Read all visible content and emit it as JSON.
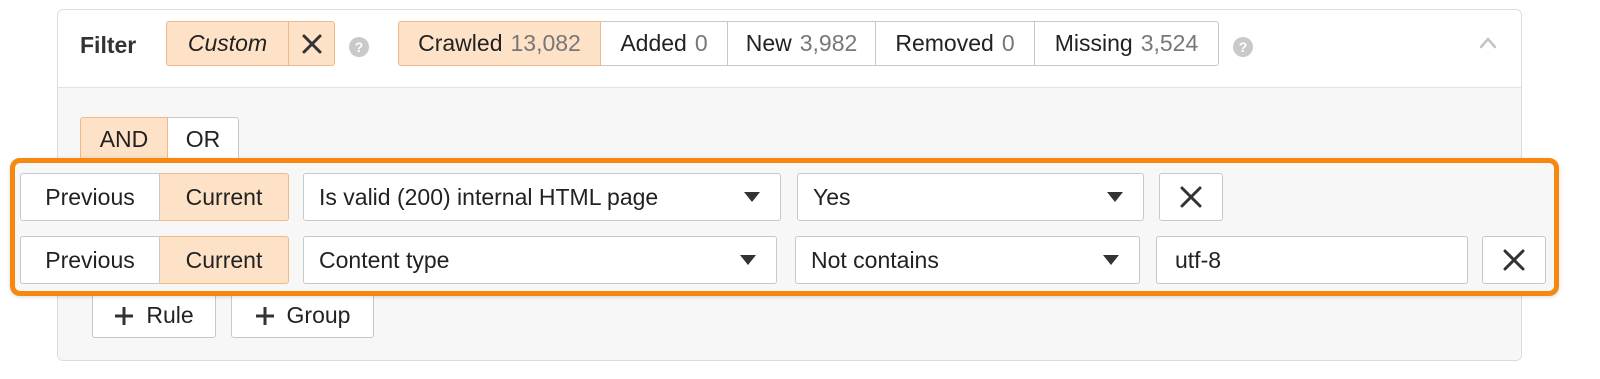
{
  "filter": {
    "label": "Filter",
    "preset": {
      "label": "Custom",
      "active": true
    },
    "tabs": [
      {
        "label": "Crawled",
        "count": "13,082",
        "active": true
      },
      {
        "label": "Added",
        "count": "0",
        "active": false
      },
      {
        "label": "New",
        "count": "3,982",
        "active": false
      },
      {
        "label": "Removed",
        "count": "0",
        "active": false
      },
      {
        "label": "Missing",
        "count": "3,524",
        "active": false
      }
    ],
    "help_glyph": "?"
  },
  "logic": {
    "and_label": "AND",
    "or_label": "OR",
    "selected": "AND"
  },
  "rules": [
    {
      "previous_label": "Previous",
      "current_label": "Current",
      "selected_scope": "Current",
      "field": "Is valid (200) internal HTML page",
      "operator": "Yes",
      "value": null
    },
    {
      "previous_label": "Previous",
      "current_label": "Current",
      "selected_scope": "Current",
      "field": "Content type",
      "operator": "Not contains",
      "value": "utf-8"
    }
  ],
  "actions": {
    "rule_label": "Rule",
    "group_label": "Group"
  },
  "colors": {
    "accent_fill": "#fde2c8",
    "accent_border": "#f1b988",
    "highlight": "#f7880f"
  },
  "icons": [
    "close-icon",
    "help-icon",
    "chevron-up-icon",
    "caret-down-icon",
    "plus-icon"
  ]
}
